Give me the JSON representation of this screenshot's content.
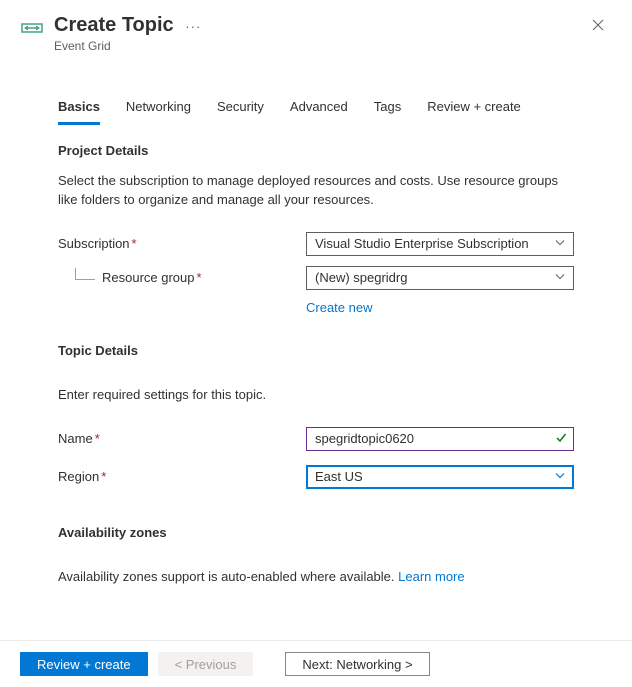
{
  "header": {
    "title": "Create Topic",
    "subtitle": "Event Grid"
  },
  "tabs": {
    "basics": "Basics",
    "networking": "Networking",
    "security": "Security",
    "advanced": "Advanced",
    "tags": "Tags",
    "review": "Review + create"
  },
  "project": {
    "section": "Project Details",
    "desc": "Select the subscription to manage deployed resources and costs. Use resource groups like folders to organize and manage all your resources.",
    "subscription_label": "Subscription",
    "subscription_value": "Visual Studio Enterprise Subscription",
    "rg_label": "Resource group",
    "rg_value": "(New) spegridrg",
    "create_new": "Create new"
  },
  "topic": {
    "section": "Topic Details",
    "desc": "Enter required settings for this topic.",
    "name_label": "Name",
    "name_value": "spegridtopic0620",
    "region_label": "Region",
    "region_value": "East US"
  },
  "availability": {
    "section": "Availability zones",
    "desc": "Availability zones support is auto-enabled where available. ",
    "learn_more": "Learn more"
  },
  "footer": {
    "review": "Review + create",
    "prev": "< Previous",
    "next": "Next: Networking >"
  }
}
